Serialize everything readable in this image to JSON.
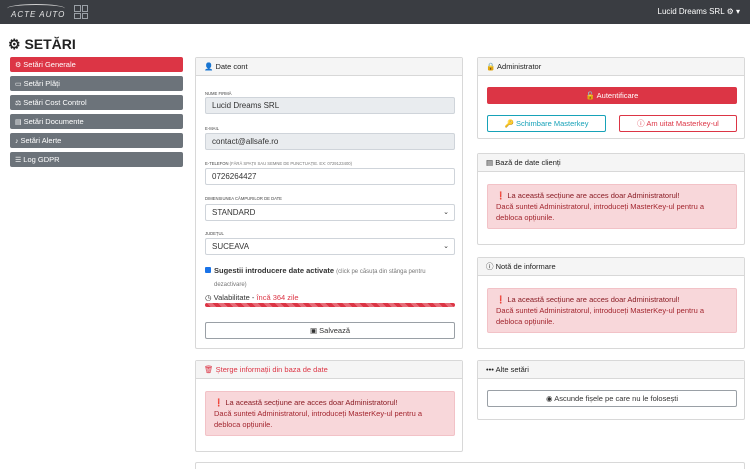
{
  "topbar": {
    "logo_text": "ACTE AUTO",
    "company_menu": "Lucid Dreams SRL ⚙ ▾"
  },
  "page": {
    "title": "SETĂRI"
  },
  "sidebar": {
    "items": [
      {
        "label": "Setări Generale",
        "active": true
      },
      {
        "label": "Setări Plăți"
      },
      {
        "label": "Setări Cost Control"
      },
      {
        "label": "Setări Documente"
      },
      {
        "label": "Setări Alerte"
      },
      {
        "label": "Log GDPR"
      }
    ]
  },
  "account": {
    "header": "Date cont",
    "firm_label": "NUME FIRMĂ",
    "firm_value": "Lucid Dreams SRL",
    "email_label": "E-MAIL",
    "email_value": "contact@allsafe.ro",
    "phone_label": "E-TELEFON",
    "phone_hint": "(FĂRĂ SPAȚII SAU SEMNE DE PUNCTUAȚIE. EX: 0729123400)",
    "phone_value": "0726264427",
    "dimension_label": "DIMENSIUNEA CÂMPURILOR DE DATE",
    "dimension_value": "STANDARD",
    "county_label": "JUDEȚUL",
    "county_value": "SUCEAVA",
    "suggestions_label": "Sugestii introducere date activate",
    "suggestions_hint": "(click pe căsuța din stânga pentru dezactivare)",
    "validity_label": "Valabilitate - ",
    "validity_value": "încă 364 zile",
    "validity_progress": 1.0,
    "save_button": "Salvează"
  },
  "delete_section": {
    "header": "Șterge informații din baza de date",
    "alert_title": "La această secțiune are acces doar Administratorul!",
    "alert_body": "Dacă sunteti Administratorul, introduceți MasterKey-ul pentru a debloca opțiunile."
  },
  "admin": {
    "header": "Administrator",
    "login_button": "Autentificare",
    "change_button": "Schimbare Masterkey",
    "forgot_button": "Am uitat Masterkey-ul"
  },
  "client_db": {
    "header": "Bază de date clienți",
    "alert_title": "La această secțiune are acces doar Administratorul!",
    "alert_body": "Dacă sunteti Administratorul, introduceți MasterKey-ul pentru a debloca opțiunile."
  },
  "info_note": {
    "header": "Notă de informare",
    "alert_title": "La această secțiune are acces doar Administratorul!",
    "alert_body": "Dacă sunteti Administratorul, introduceți MasterKey-ul pentru a debloca opțiunile."
  },
  "other": {
    "header": "Alte setări",
    "hide_button": "Ascunde fișele pe care nu le folosești"
  },
  "colors": {
    "accent": "#dc3545",
    "topbar": "#3a3d42",
    "info": "#17a2b8"
  }
}
